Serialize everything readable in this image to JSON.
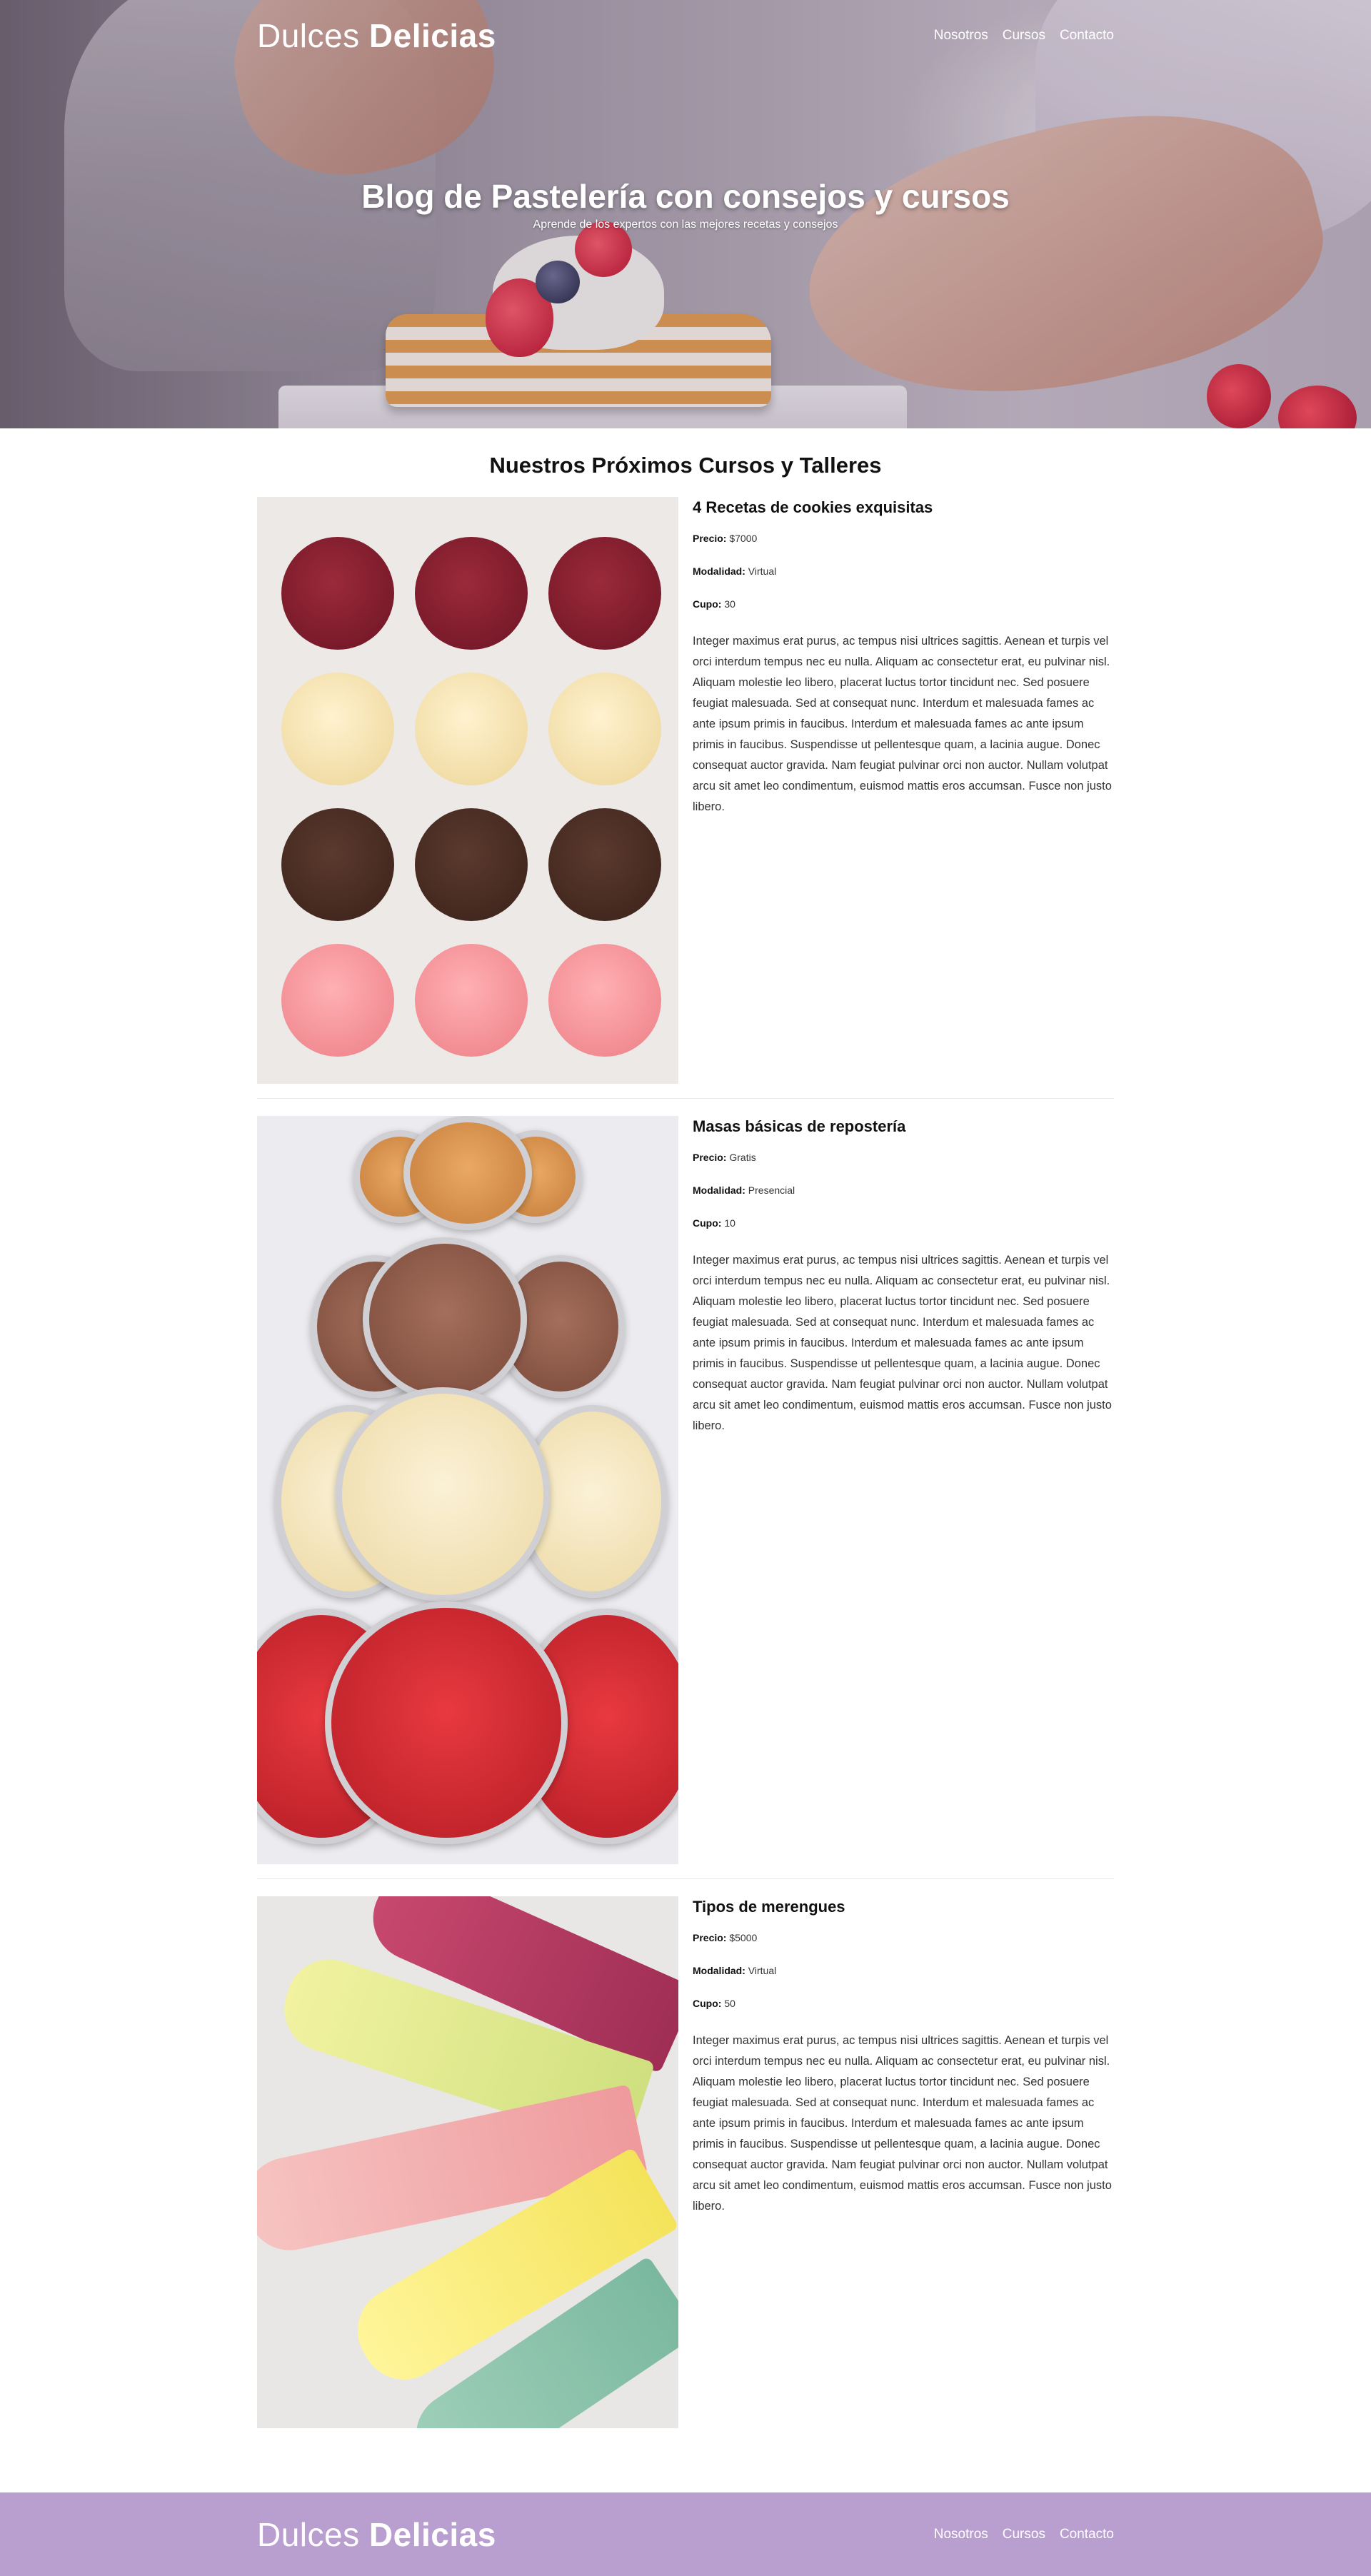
{
  "brand": {
    "name_light": "Dulces",
    "name_bold": "Delicias"
  },
  "nav": {
    "items": [
      "Nosotros",
      "Cursos",
      "Contacto"
    ]
  },
  "hero": {
    "title": "Blog de Pastelería con consejos y cursos",
    "subtitle": "Aprende de los expertos con las mejores recetas y consejos"
  },
  "courses_section": {
    "title": "Nuestros Próximos Cursos y Talleres",
    "labels": {
      "price": "Precio:",
      "mode": "Modalidad:",
      "spots": "Cupo:"
    },
    "courses": [
      {
        "title": "4 Recetas de cookies exquisitas",
        "price": "$7000",
        "mode": "Virtual",
        "spots": "30",
        "description": "Integer maximus erat purus, ac tempus nisi ultrices sagittis. Aenean et turpis vel orci interdum tempus nec eu nulla. Aliquam ac consectetur erat, eu pulvinar nisl. Aliquam molestie leo libero, placerat luctus tortor tincidunt nec. Sed posuere feugiat malesuada. Sed at consequat nunc. Interdum et malesuada fames ac ante ipsum primis in faucibus. Interdum et malesuada fames ac ante ipsum primis in faucibus. Suspendisse ut pellentesque quam, a lacinia augue. Donec consequat auctor gravida. Nam feugiat pulvinar orci non auctor. Nullam volutpat arcu sit amet leo condimentum, euismod mattis eros accumsan. Fusce non justo libero."
      },
      {
        "title": "Masas básicas de repostería",
        "price": "Gratis",
        "mode": "Presencial",
        "spots": "10",
        "description": "Integer maximus erat purus, ac tempus nisi ultrices sagittis. Aenean et turpis vel orci interdum tempus nec eu nulla. Aliquam ac consectetur erat, eu pulvinar nisl. Aliquam molestie leo libero, placerat luctus tortor tincidunt nec. Sed posuere feugiat malesuada. Sed at consequat nunc. Interdum et malesuada fames ac ante ipsum primis in faucibus. Interdum et malesuada fames ac ante ipsum primis in faucibus. Suspendisse ut pellentesque quam, a lacinia augue. Donec consequat auctor gravida. Nam feugiat pulvinar orci non auctor. Nullam volutpat arcu sit amet leo condimentum, euismod mattis eros accumsan. Fusce non justo libero."
      },
      {
        "title": "Tipos de merengues",
        "price": "$5000",
        "mode": "Virtual",
        "spots": "50",
        "description": "Integer maximus erat purus, ac tempus nisi ultrices sagittis. Aenean et turpis vel orci interdum tempus nec eu nulla. Aliquam ac consectetur erat, eu pulvinar nisl. Aliquam molestie leo libero, placerat luctus tortor tincidunt nec. Sed posuere feugiat malesuada. Sed at consequat nunc. Interdum et malesuada fames ac ante ipsum primis in faucibus. Interdum et malesuada fames ac ante ipsum primis in faucibus. Suspendisse ut pellentesque quam, a lacinia augue. Donec consequat auctor gravida. Nam feugiat pulvinar orci non auctor. Nullam volutpat arcu sit amet leo condimentum, euismod mattis eros accumsan. Fusce non justo libero."
      }
    ]
  },
  "footer": {
    "nav_items": [
      "Nosotros",
      "Cursos",
      "Contacto"
    ]
  },
  "colors": {
    "footer_bg": "#b99fcf",
    "text": "#333333",
    "heading": "#111111"
  }
}
